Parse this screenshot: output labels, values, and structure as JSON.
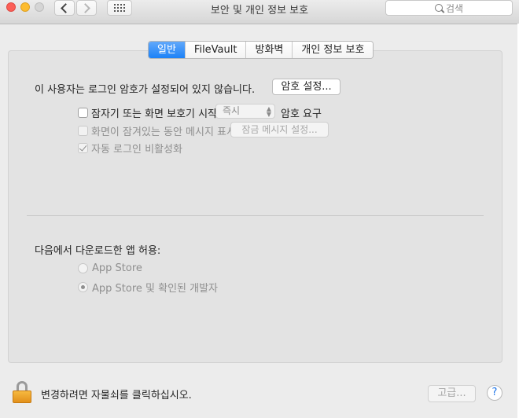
{
  "window": {
    "title": "보안 및 개인 정보 보호",
    "search_placeholder": "검색"
  },
  "tabs": [
    {
      "label": "일반",
      "active": true
    },
    {
      "label": "FileVault",
      "active": false
    },
    {
      "label": "방화벽",
      "active": false
    },
    {
      "label": "개인 정보 보호",
      "active": false
    }
  ],
  "general": {
    "password_message": "이 사용자는 로그인 암호가 설정되어 있지 않습니다.",
    "password_button": "암호 설정...",
    "require_password": {
      "label": "잠자기 또는 화면 보호기 시작",
      "checked": false,
      "delay_value": "즉시",
      "suffix": "암호 요구"
    },
    "show_message": {
      "label": "화면이 잠겨있는 동안 메시지 표시",
      "checked": false,
      "button": "잠금 메시지 설정..."
    },
    "disable_auto_login": {
      "label": "자동 로그인 비활성화",
      "checked": true
    },
    "allow_apps": {
      "label": "다음에서 다운로드한 앱 허용:",
      "options": [
        {
          "label": "App Store",
          "selected": false
        },
        {
          "label": "App Store 및 확인된 개발자",
          "selected": true
        }
      ]
    }
  },
  "footer": {
    "lock_message": "변경하려면 자물쇠를 클릭하십시오.",
    "advanced_button": "고급...",
    "help_label": "?"
  },
  "colors": {
    "accent": "#1c82f7",
    "background": "#ececec",
    "panel": "#e3e3e3"
  }
}
